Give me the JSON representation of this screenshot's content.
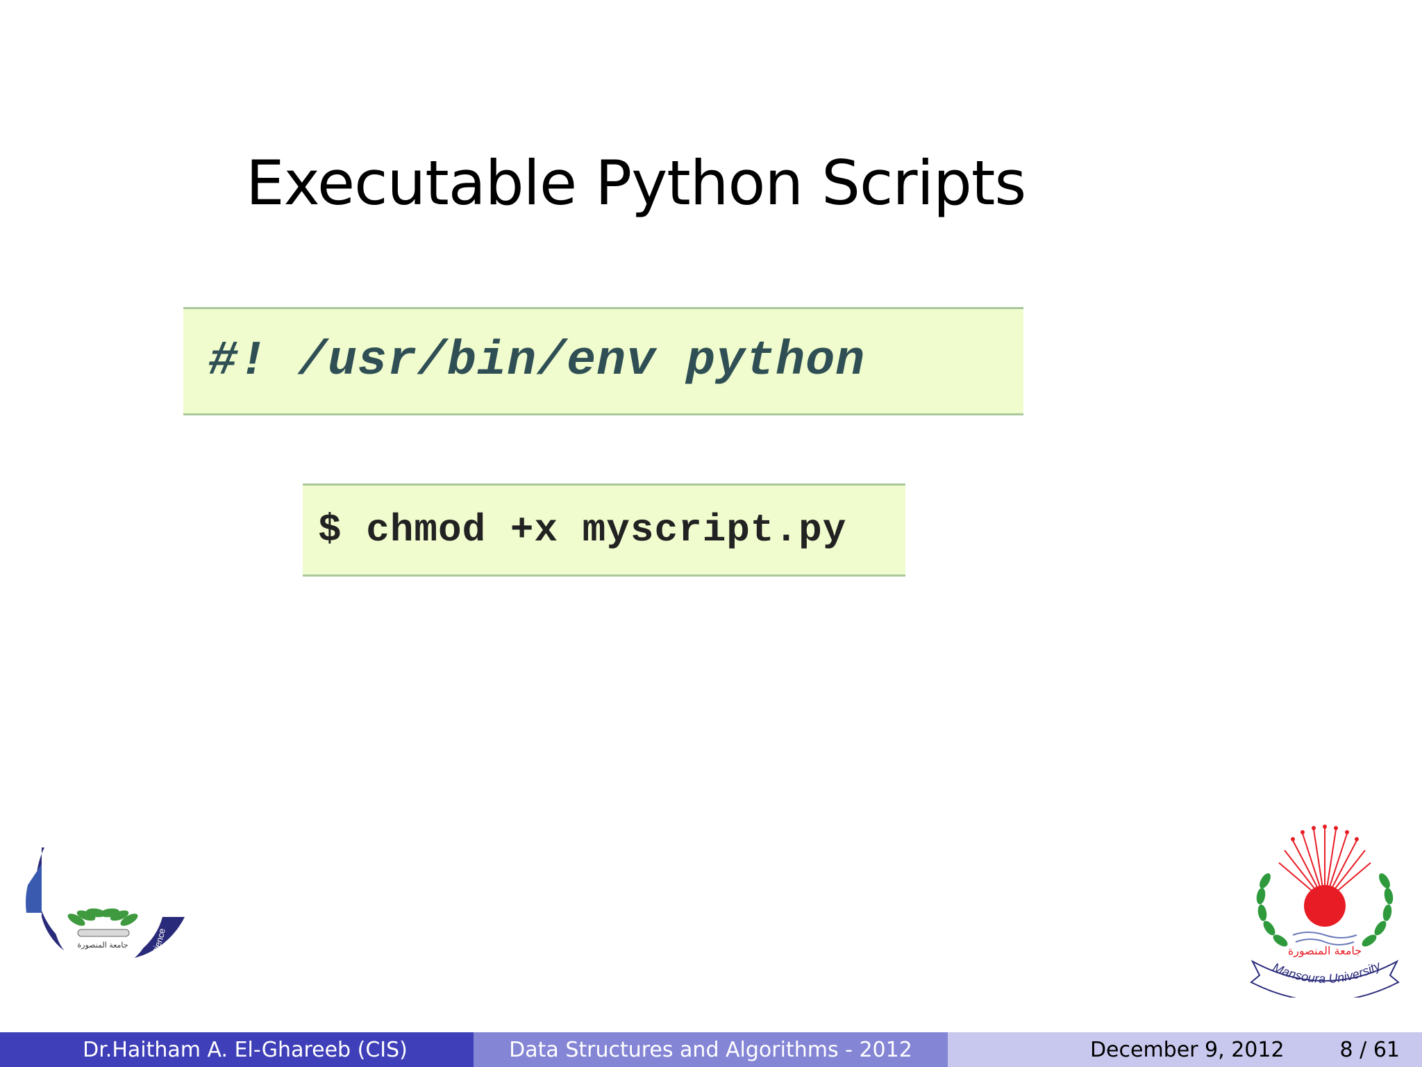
{
  "slide": {
    "title": "Executable Python Scripts",
    "code_blocks": [
      "#! /usr/bin/env python",
      "$ chmod +x myscript.py"
    ]
  },
  "logos": {
    "faculty": {
      "text": "Faculty of Computers and Information Science",
      "icon": "faculty-emblem-icon",
      "colors": {
        "ring": "#2a2a7a",
        "leaves": "#3f9a3f"
      }
    },
    "university": {
      "text": "Mansoura University",
      "icon": "mansoura-university-emblem-icon",
      "colors": {
        "sun": "#e81c24",
        "leaves": "#2e9a3c"
      }
    }
  },
  "footer": {
    "author": "Dr.Haitham A. El-Ghareeb  (CIS)",
    "course": "Data Structures and Algorithms - 2012",
    "date": "December 9, 2012",
    "page": "8 / 61",
    "colors": {
      "left": "#3f3fb9",
      "center": "#8585d6",
      "right": "#c8c8ee"
    }
  }
}
